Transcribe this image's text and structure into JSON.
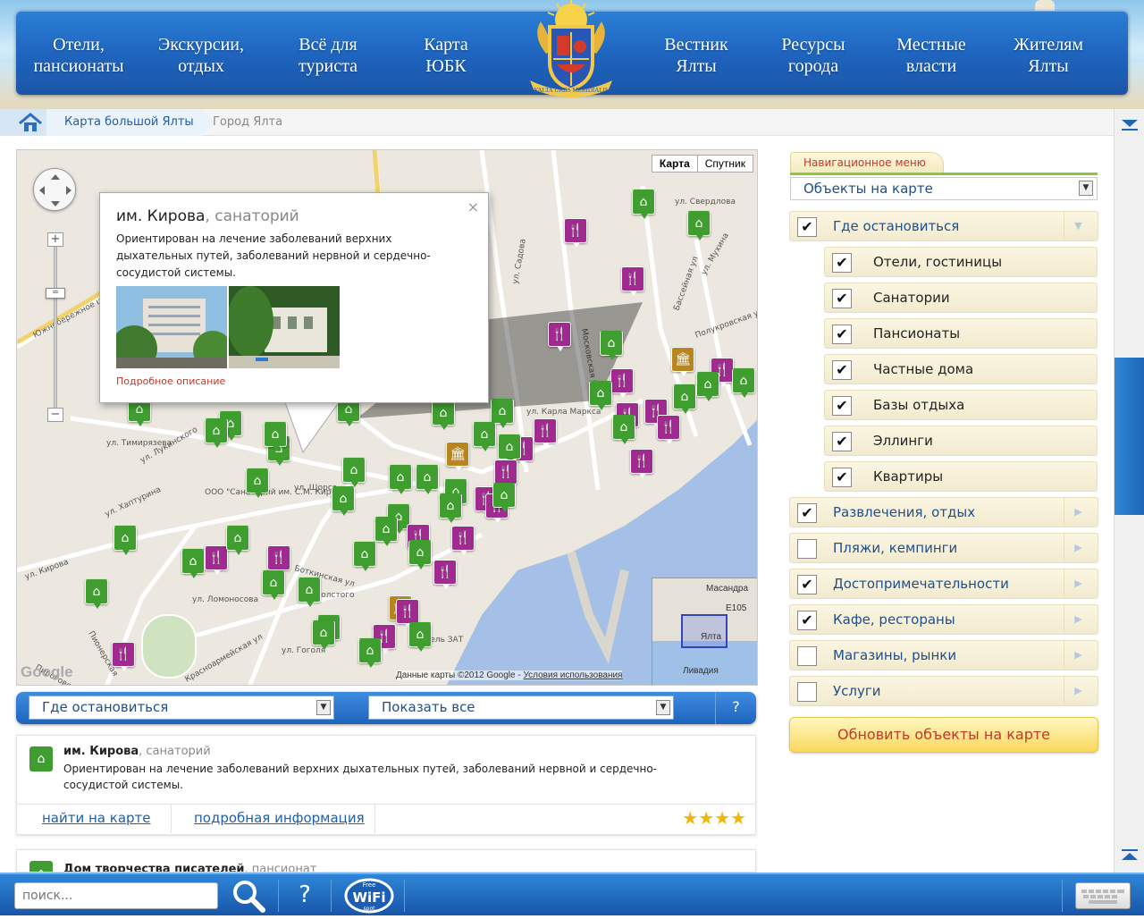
{
  "nav": {
    "items": [
      {
        "label": "Отели,\nпансионаты"
      },
      {
        "label": "Экскурсии,\nотдых"
      },
      {
        "label": "Всё для\nтуриста"
      },
      {
        "label": "Карта\nЮБК"
      },
      {
        "label": "Вестник\nЯлты"
      },
      {
        "label": "Ресурсы\nгорода"
      },
      {
        "label": "Местные\nвласти"
      },
      {
        "label": "Жителям\nЯлты"
      }
    ],
    "emblem_text": "YALTA URBS MERIDIALIS"
  },
  "breadcrumb": {
    "items": [
      "Карта большой Ялты",
      "Город Ялта"
    ]
  },
  "map": {
    "type_buttons": [
      "Карта",
      "Спутник"
    ],
    "popup": {
      "title": "им. Кирова",
      "kind": ", санаторий",
      "description": "Ориентирован на лечение заболеваний верхних дыхательных путей, заболеваний нервной и сердечно-сосудистой системы.",
      "link": "Подробное описание",
      "close": "×"
    },
    "google_logo": "Google",
    "attribution": "Данные карты ©2012 Google - ",
    "terms_link": "Условия использования",
    "overview_labels": [
      "Ялта",
      "Ливадия",
      "E105",
      "Масандра"
    ],
    "street_labels": [
      "ул. Кирова",
      "ул. Карла Маркса",
      "ул. Свердлова",
      "Московская ул",
      "Боткинская ул",
      "ул. Гоголя",
      "Красноармейская ул",
      "ул. Ломоносова",
      "ул. Толстого",
      "ул. Щорса",
      "ул. Садова",
      "ООО \"Санаторий им. С.М. Кирова\"",
      "Отель ЗАТ",
      "ул. Хаптурина",
      "Пироговская ул",
      "ул. Лукинского",
      "ул. Тимирязева",
      "Южнобережное ш",
      "Пионерская",
      "Полукровская ул",
      "ул. Мухина",
      "Бассейная ул"
    ]
  },
  "filter": {
    "category": "Где остановиться",
    "show": "Показать все",
    "help": "?"
  },
  "results": [
    {
      "title": "им. Кирова",
      "kind": ", санаторий",
      "description": "Ориентирован на лечение заболеваний верхних дыхательных путей, заболеваний нервной и сердечно-сосудистой системы.",
      "find_link": "найти на карте",
      "info_link": "подробная информация",
      "stars": "★★★★"
    },
    {
      "title": "Дом творчества писателей",
      "kind": ", пансионат"
    }
  ],
  "sidebar": {
    "tab": "Навигационное меню",
    "select": "Объекты на карте",
    "categories": [
      {
        "label": "Где остановиться",
        "checked": "✔"
      },
      {
        "label": "Отели, гостиницы",
        "checked": "✔"
      },
      {
        "label": "Санатории",
        "checked": "✔"
      },
      {
        "label": "Пансионаты",
        "checked": "✔"
      },
      {
        "label": "Частные дома",
        "checked": "✔"
      },
      {
        "label": "Базы отдыха",
        "checked": "✔"
      },
      {
        "label": "Эллинги",
        "checked": "✔"
      },
      {
        "label": "Квартиры",
        "checked": "✔"
      },
      {
        "label": "Развлечения, отдых",
        "checked": "✔"
      },
      {
        "label": "Пляжи, кемпинги",
        "checked": ""
      },
      {
        "label": "Достопримечательности",
        "checked": "✔"
      },
      {
        "label": "Кафе, рестораны",
        "checked": "✔"
      },
      {
        "label": "Магазины, рынки",
        "checked": ""
      },
      {
        "label": "Услуги",
        "checked": ""
      }
    ],
    "update_button": "Обновить объекты на карте"
  },
  "bottom": {
    "search_placeholder": "поиск...",
    "help": "?",
    "wifi": "WiFi",
    "wifi_top": "Free",
    "wifi_bottom": "spot"
  },
  "colors": {
    "nav_blue": "#1e63bd",
    "hotel_marker": "#3f9e2f",
    "food_marker": "#a02a8f",
    "sight_marker": "#b8861c",
    "accent_red": "#c0392b",
    "link_blue": "#1f5fa8"
  }
}
